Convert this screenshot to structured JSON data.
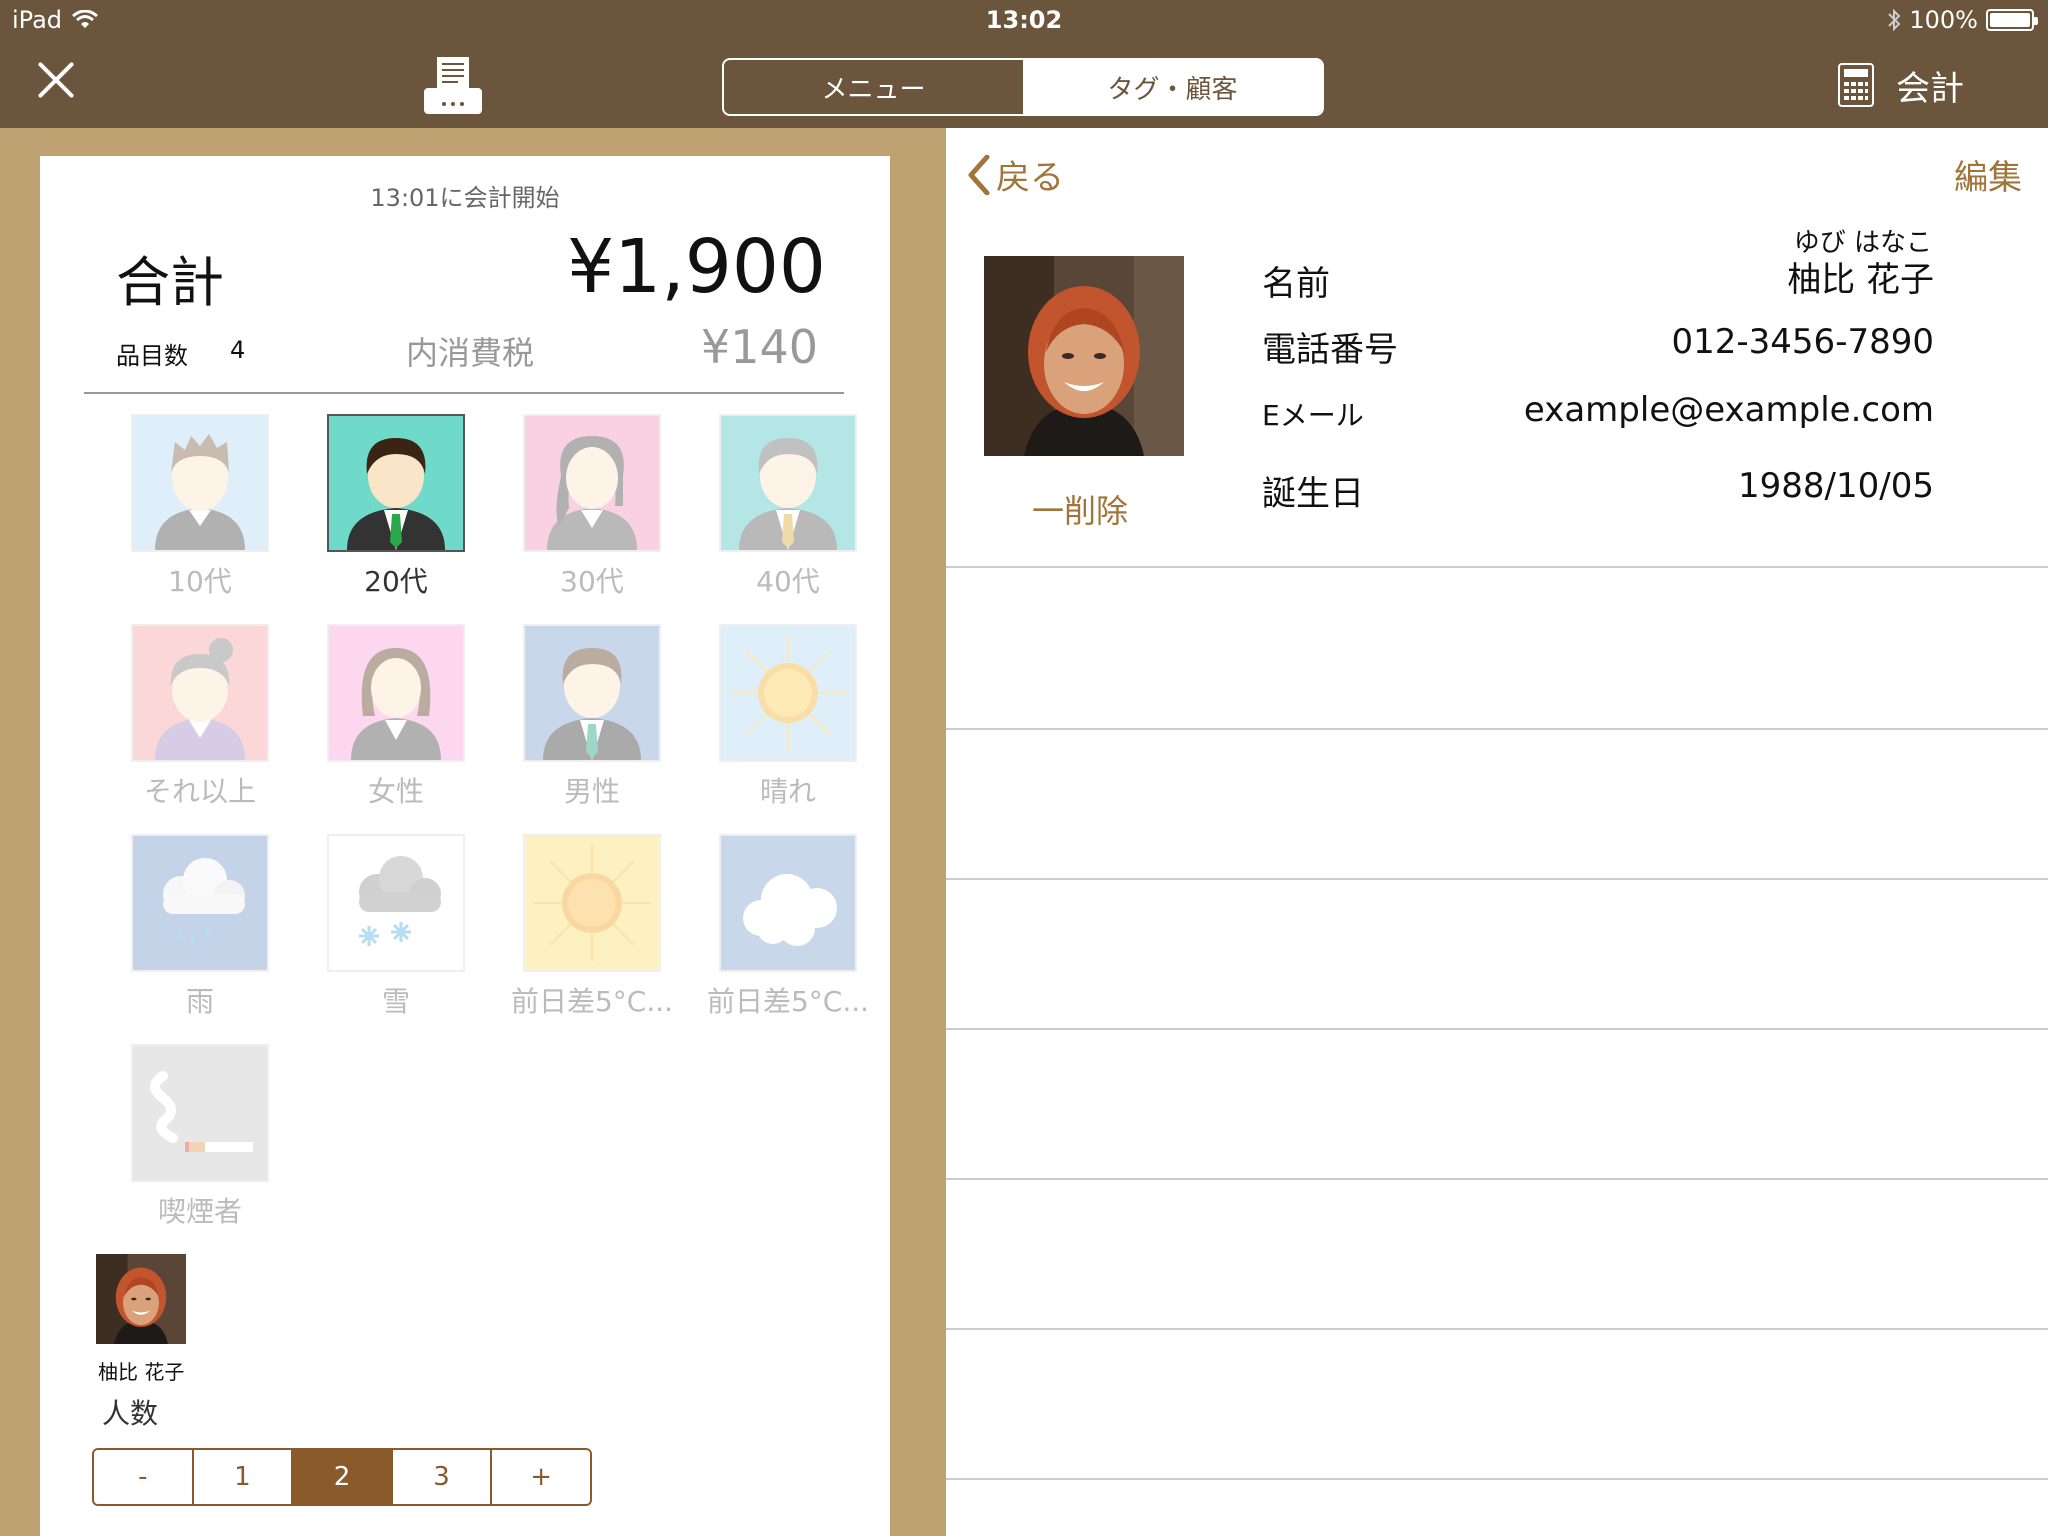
{
  "status_bar": {
    "device": "iPad",
    "time": "13:02",
    "battery": "100%",
    "battery_level": 1.0
  },
  "nav": {
    "segments": [
      {
        "label": "メニュー",
        "active": false
      },
      {
        "label": "タグ・顧客",
        "active": true
      }
    ],
    "checkout_label": "会計",
    "icons": [
      "close-icon",
      "printer-icon",
      "calculator-icon"
    ]
  },
  "receipt": {
    "started": "13:01に会計開始",
    "total_label": "合計",
    "total_value": "¥1,900",
    "count_label": "品目数",
    "count_value": "4",
    "tax_label": "内消費税",
    "tax_value": "¥140"
  },
  "tags": [
    {
      "label": "10代",
      "selected": false
    },
    {
      "label": "20代",
      "selected": true
    },
    {
      "label": "30代",
      "selected": false
    },
    {
      "label": "40代",
      "selected": false
    },
    {
      "label": "それ以上",
      "selected": false
    },
    {
      "label": "女性",
      "selected": false
    },
    {
      "label": "男性",
      "selected": false
    },
    {
      "label": "晴れ",
      "selected": false
    },
    {
      "label": "雨",
      "selected": false
    },
    {
      "label": "雪",
      "selected": false
    },
    {
      "label": "前日差5°C...",
      "selected": false
    },
    {
      "label": "前日差5°C...",
      "selected": false
    },
    {
      "label": "喫煙者",
      "selected": false
    }
  ],
  "customer_chip": {
    "name": "柚比 花子"
  },
  "people": {
    "label": "人数",
    "options": [
      {
        "label": "-",
        "active": false
      },
      {
        "label": "1",
        "active": false
      },
      {
        "label": "2",
        "active": true
      },
      {
        "label": "3",
        "active": false
      },
      {
        "label": "+",
        "active": false
      }
    ]
  },
  "detail": {
    "back_label": "戻る",
    "edit_label": "編集",
    "delete_label": "一削除",
    "name_reading": "ゆび はなこ",
    "fields": [
      {
        "label": "名前",
        "value": "柚比 花子"
      },
      {
        "label": "電話番号",
        "value": "012-3456-7890"
      },
      {
        "label": "Eメール",
        "value": "example@example.com"
      },
      {
        "label": "誕生日",
        "value": "1988/10/05"
      }
    ]
  },
  "colors": {
    "nav_bg": "#6b563d",
    "side_bg": "#bea272",
    "accent": "#a0743a",
    "stepper": "#8a5a2a"
  }
}
